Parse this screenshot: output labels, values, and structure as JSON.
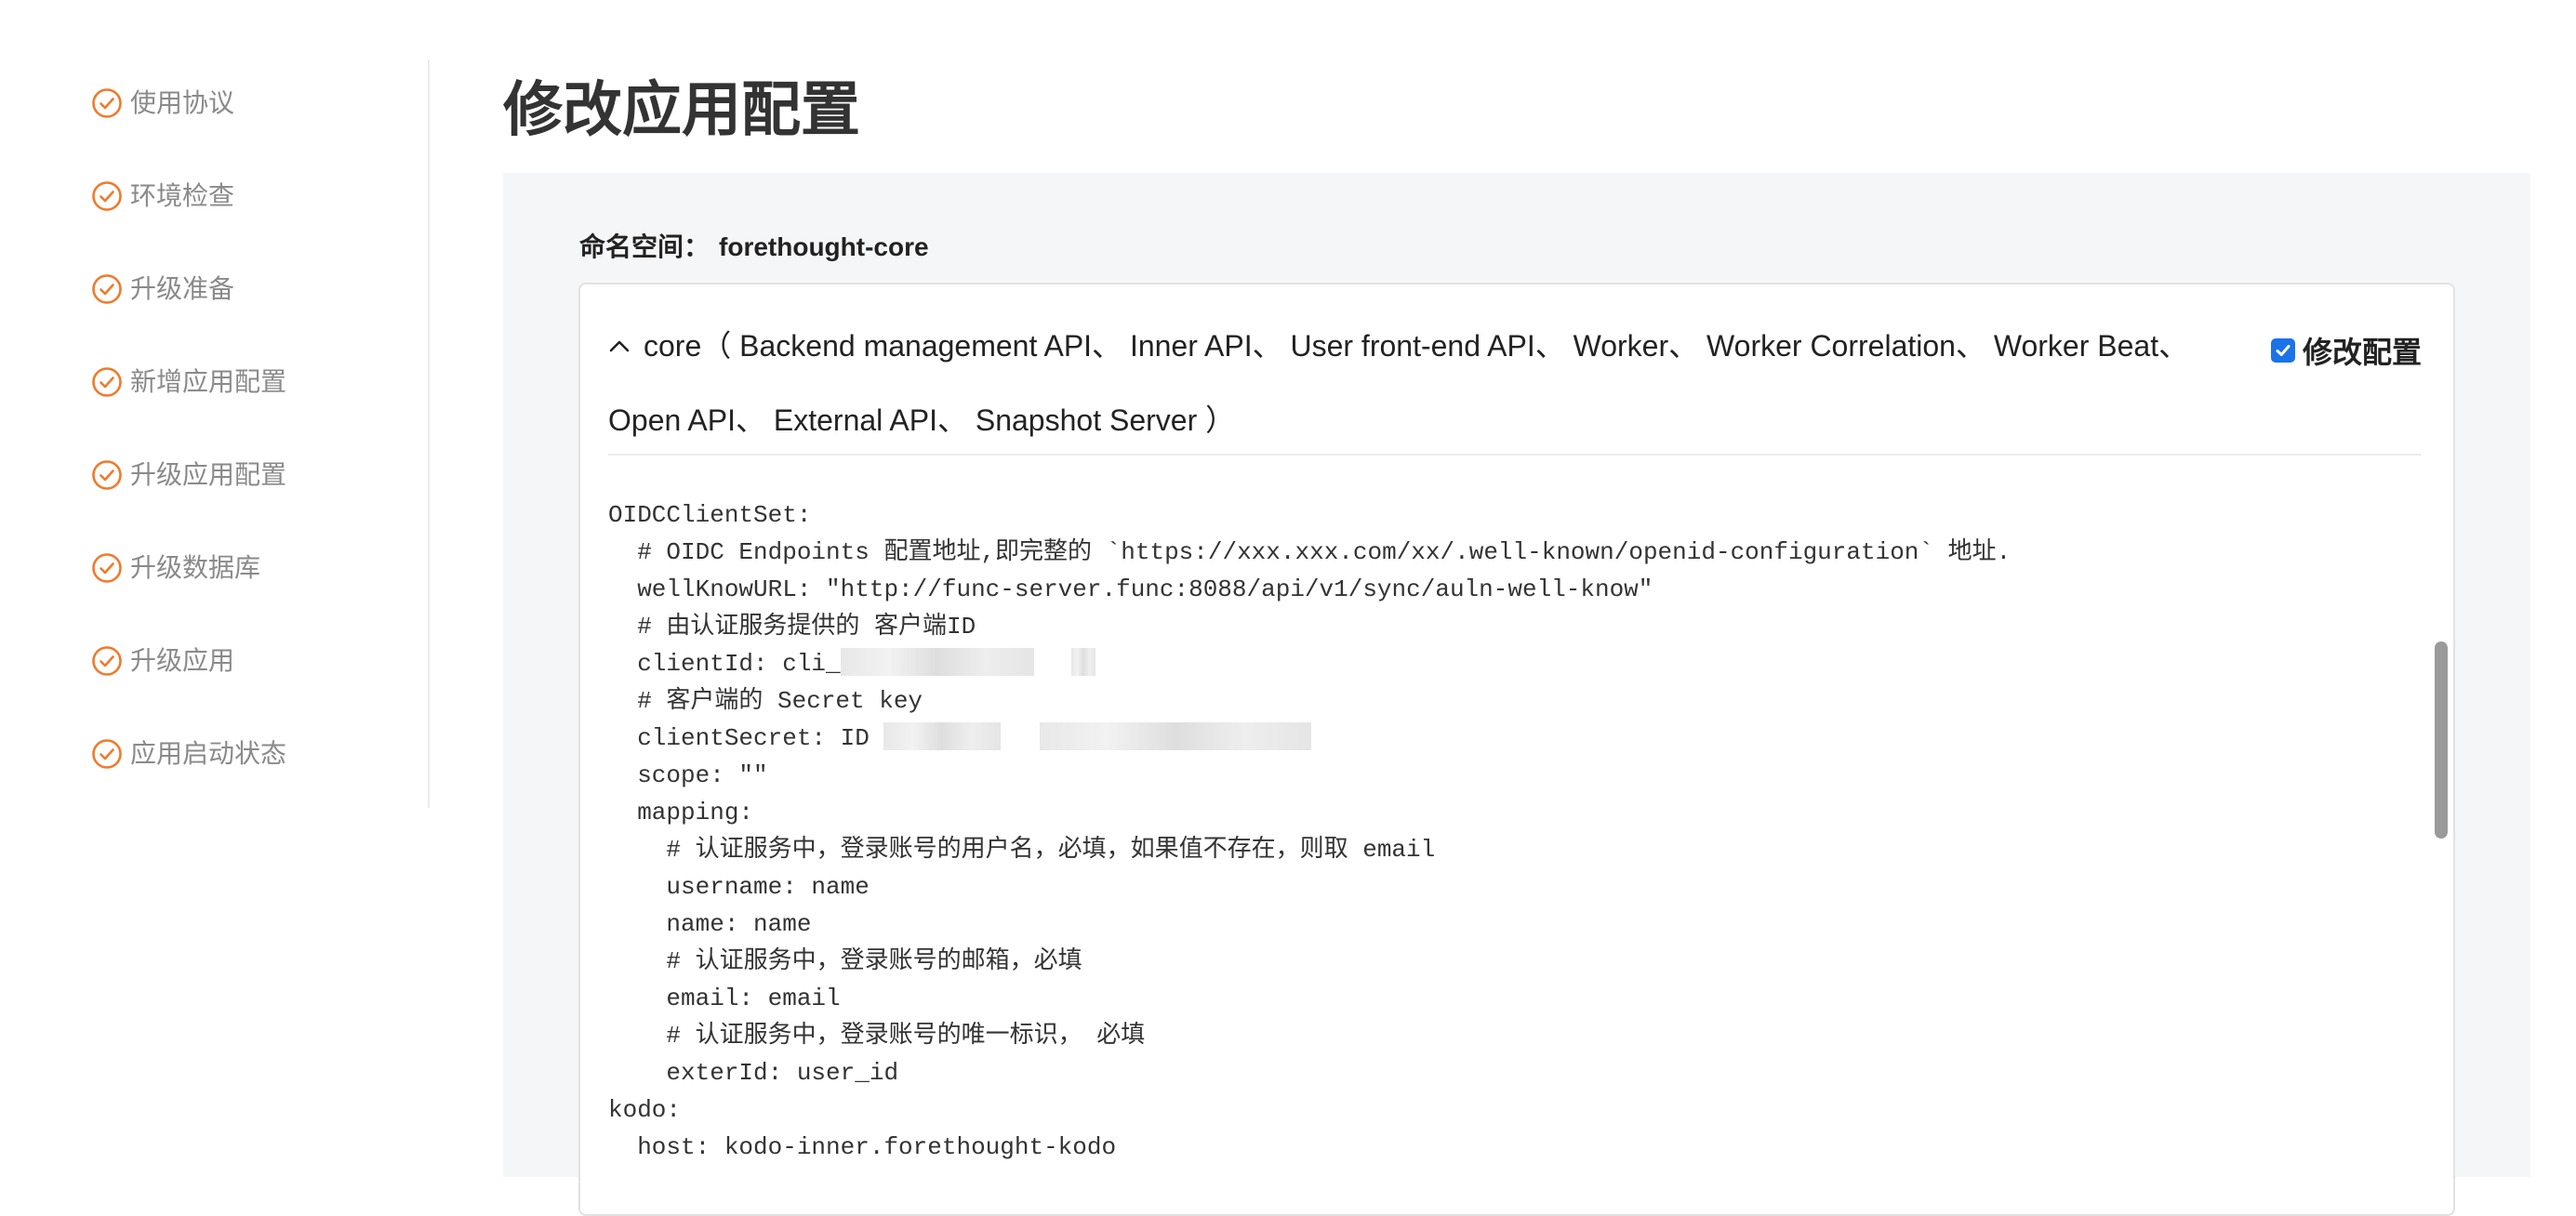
{
  "sidebar": {
    "items": [
      {
        "label": "使用协议"
      },
      {
        "label": "环境检查"
      },
      {
        "label": "升级准备"
      },
      {
        "label": "新增应用配置"
      },
      {
        "label": "升级应用配置"
      },
      {
        "label": "升级数据库"
      },
      {
        "label": "升级应用"
      },
      {
        "label": "应用启动状态"
      }
    ],
    "icon": "check-circle-icon",
    "accent_color": "#f07a2a"
  },
  "page": {
    "title": "修改应用配置"
  },
  "namespace": {
    "label": "命名空间：",
    "value": "forethought-core"
  },
  "card": {
    "header_line1": "core（ Backend management API、 Inner API、 User front-end API、 Worker、 Worker Correlation、 Worker Beat、",
    "header_line2": "Open API、 External API、 Snapshot Server ）",
    "caret_icon": "chevron-up-icon",
    "checkbox_label": "修改配置",
    "checkbox_checked": true,
    "checkbox_color": "#1a73e8"
  },
  "code": {
    "lines": [
      "OIDCClientSet:",
      "  # OIDC Endpoints 配置地址,即完整的 `https://xxx.xxx.com/xx/.well-known/openid-configuration` 地址.",
      "  wellKnowURL: \"http://func-server.func:8088/api/v1/sync/auln-well-know\"",
      "  # 由认证服务提供的 客户端ID",
      "  clientId: cli_",
      "  # 客户端的 Secret key",
      "  clientSecret: ID ",
      "  scope: \"\"",
      "  mapping:",
      "    # 认证服务中，登录账号的用户名，必填，如果值不存在，则取 email",
      "    username: name",
      "    name: name",
      "    # 认证服务中，登录账号的邮箱，必填",
      "    email: email",
      "    # 认证服务中，登录账号的唯一标识， 必填",
      "    exterId: user_id",
      "kodo:",
      "  host: kodo-inner.forethought-kodo"
    ]
  }
}
